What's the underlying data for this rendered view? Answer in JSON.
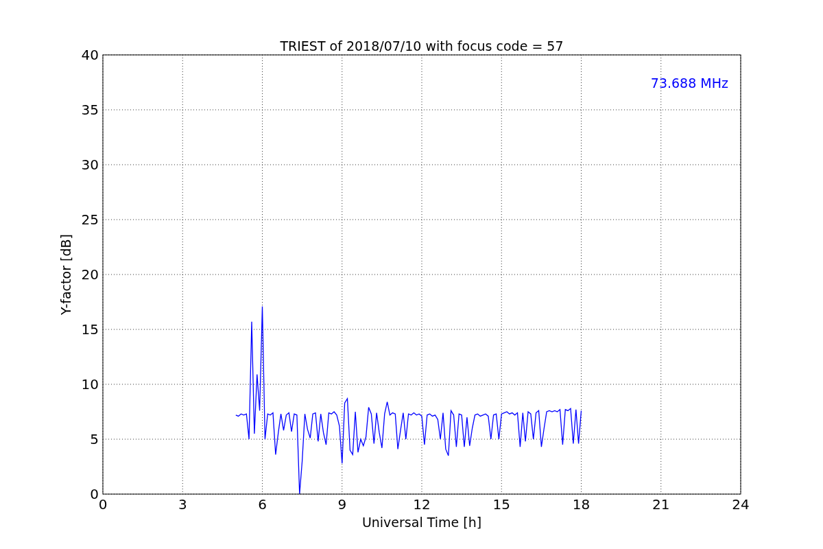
{
  "plot": {
    "chart_data": {
      "type": "line",
      "title": "TRIEST of 2018/07/10 with focus code = 57",
      "xlabel": "Universal Time [h]",
      "ylabel": "Y-factor [dB]",
      "xlim": [
        0,
        24
      ],
      "ylim": [
        0,
        40
      ],
      "xticks": [
        0,
        3,
        6,
        9,
        12,
        15,
        18,
        21,
        24
      ],
      "yticks": [
        0,
        5,
        10,
        15,
        20,
        25,
        30,
        35,
        40
      ],
      "grid": true,
      "x": [
        5.0,
        5.1,
        5.2,
        5.3,
        5.4,
        5.5,
        5.6,
        5.7,
        5.8,
        5.9,
        6.0,
        6.1,
        6.2,
        6.3,
        6.4,
        6.5,
        6.6,
        6.7,
        6.8,
        6.9,
        7.0,
        7.1,
        7.2,
        7.3,
        7.4,
        7.5,
        7.6,
        7.7,
        7.8,
        7.9,
        8.0,
        8.1,
        8.2,
        8.3,
        8.4,
        8.5,
        8.6,
        8.7,
        8.8,
        8.9,
        9.0,
        9.1,
        9.2,
        9.3,
        9.4,
        9.5,
        9.6,
        9.7,
        9.8,
        9.9,
        10.0,
        10.1,
        10.2,
        10.3,
        10.4,
        10.5,
        10.6,
        10.7,
        10.8,
        10.9,
        11.0,
        11.1,
        11.2,
        11.3,
        11.4,
        11.5,
        11.6,
        11.7,
        11.8,
        11.9,
        12.0,
        12.1,
        12.2,
        12.3,
        12.4,
        12.5,
        12.6,
        12.7,
        12.8,
        12.9,
        13.0,
        13.1,
        13.2,
        13.3,
        13.4,
        13.5,
        13.6,
        13.7,
        13.8,
        13.9,
        14.0,
        14.1,
        14.2,
        14.3,
        14.4,
        14.5,
        14.6,
        14.7,
        14.8,
        14.9,
        15.0,
        15.1,
        15.2,
        15.3,
        15.4,
        15.5,
        15.6,
        15.7,
        15.8,
        15.9,
        16.0,
        16.1,
        16.2,
        16.3,
        16.4,
        16.5,
        16.6,
        16.7,
        16.8,
        16.9,
        17.0,
        17.1,
        17.2,
        17.3,
        17.4,
        17.5,
        17.6,
        17.7,
        17.8,
        17.9,
        18.0
      ],
      "series": [
        {
          "name": "73.688 MHz",
          "color": "#0000ff",
          "values": [
            7.2,
            7.1,
            7.3,
            7.2,
            7.3,
            5.0,
            15.7,
            5.5,
            10.9,
            7.6,
            17.1,
            5.0,
            7.3,
            7.2,
            7.4,
            3.6,
            5.6,
            7.3,
            5.8,
            7.2,
            7.4,
            5.7,
            7.3,
            7.2,
            0.0,
            3.0,
            7.3,
            5.9,
            5.1,
            7.3,
            7.4,
            4.8,
            7.3,
            5.6,
            4.5,
            7.4,
            7.3,
            7.5,
            7.2,
            6.2,
            2.8,
            8.3,
            8.7,
            4.0,
            3.6,
            7.5,
            3.8,
            5.0,
            4.4,
            5.2,
            7.9,
            7.3,
            4.6,
            7.4,
            5.6,
            4.2,
            7.3,
            8.4,
            7.2,
            7.4,
            7.3,
            4.1,
            5.8,
            7.4,
            5.0,
            7.3,
            7.2,
            7.4,
            7.2,
            7.3,
            7.1,
            4.5,
            7.2,
            7.3,
            7.1,
            7.2,
            6.8,
            5.0,
            7.4,
            4.1,
            3.5,
            7.6,
            7.2,
            4.3,
            7.3,
            7.2,
            4.3,
            7.0,
            4.4,
            6.0,
            7.2,
            7.3,
            7.1,
            7.2,
            7.3,
            7.1,
            5.0,
            7.2,
            7.3,
            5.0,
            7.3,
            7.4,
            7.5,
            7.3,
            7.4,
            7.2,
            7.4,
            4.3,
            7.4,
            4.8,
            7.5,
            7.3,
            5.0,
            7.4,
            7.6,
            4.3,
            6.0,
            7.5,
            7.6,
            7.5,
            7.6,
            7.5,
            7.7,
            4.5,
            7.7,
            7.6,
            7.8,
            4.6,
            7.7,
            4.6,
            7.6
          ]
        }
      ]
    }
  }
}
